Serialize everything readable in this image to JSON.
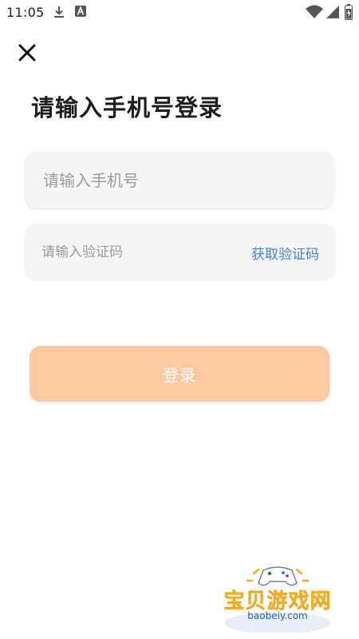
{
  "status_bar": {
    "time": "11:05",
    "icons": [
      "download-icon",
      "a-letter-icon",
      "wifi-icon",
      "signal-icon",
      "battery-icon"
    ]
  },
  "header": {
    "close_icon": "close-icon",
    "title": "请输入手机号登录"
  },
  "form": {
    "phone": {
      "placeholder": "请输入手机号",
      "value": ""
    },
    "code": {
      "placeholder": "请输入验证码",
      "value": "",
      "get_code_label": "获取验证码"
    },
    "login_label": "登录"
  },
  "watermark": {
    "title": "宝贝游戏网",
    "url": "baobeiy.com"
  },
  "colors": {
    "accent_button": "#fdc9a0",
    "link": "#4a7fd6",
    "field_bg": "#f5f5f5",
    "watermark_gold": "#f1ae1a",
    "watermark_blue": "#1b62b8"
  }
}
